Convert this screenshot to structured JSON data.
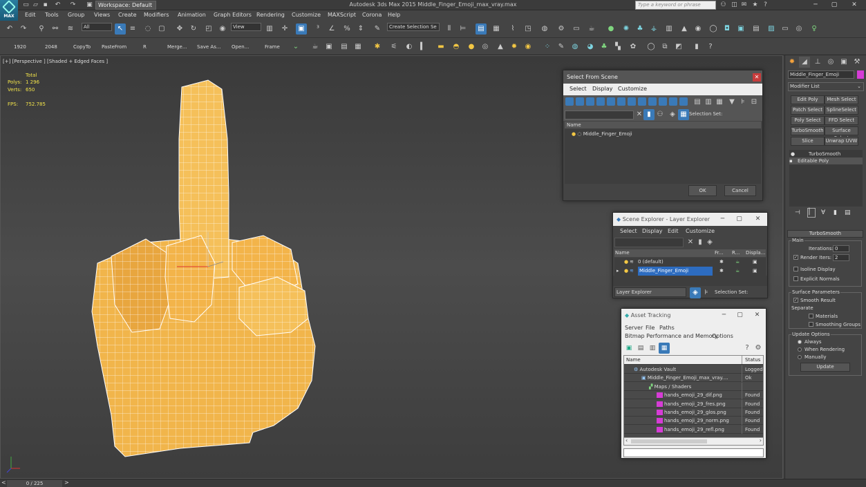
{
  "app": {
    "title": "Autodesk 3ds Max  2015     Middle_Finger_Emoji_max_vray.max",
    "logo_label": "MAX",
    "workspace": "Workspace: Default",
    "search_placeholder": "Type a keyword or phrase"
  },
  "menu": [
    "Edit",
    "Tools",
    "Group",
    "Views",
    "Create",
    "Modifiers",
    "Animation",
    "Graph Editors",
    "Rendering",
    "Customize",
    "MAXScript",
    "Corona",
    "Help"
  ],
  "toolbar": {
    "selection_filter": "All",
    "ref_coord": "View",
    "named_selection": "Create Selection Se"
  },
  "toolbar2": [
    "1920",
    "2048",
    "CopyTo",
    "PasteFrom",
    "R",
    "Merge...",
    "Save As...",
    "Open...",
    "Frame"
  ],
  "viewport": {
    "label": "[+] [Perspective ] [Shaded + Edged Faces ]",
    "stats": {
      "total_label": "Total",
      "polys_label": "Polys:",
      "polys_value": "1 296",
      "verts_label": "Verts:",
      "verts_value": "650",
      "fps_label": "FPS:",
      "fps_value": "752.785"
    },
    "model_color": "#f1b54b"
  },
  "select_from_scene": {
    "title": "Select From Scene",
    "menu": [
      "Select",
      "Display",
      "Customize"
    ],
    "selection_set_label": "Selection Set:",
    "column_name": "Name",
    "item": "Middle_Finger_Emoji",
    "ok": "OK",
    "cancel": "Cancel"
  },
  "scene_explorer": {
    "title": "Scene Explorer - Layer Explorer",
    "menu": [
      "Select",
      "Display",
      "Edit",
      "Customize"
    ],
    "columns": [
      "Name",
      "Fr...",
      "R...",
      "Displa..."
    ],
    "rows": [
      "0 (default)",
      "Middle_Finger_Emoji"
    ],
    "footer_dropdown": "Layer Explorer",
    "selection_set_label": "Selection Set:"
  },
  "asset_tracking": {
    "title": "Asset Tracking",
    "menu1": [
      "Server",
      "File",
      "Paths"
    ],
    "menu2": [
      "Bitmap Performance and Memory",
      "Options"
    ],
    "columns": [
      "Name",
      "Status"
    ],
    "rows": [
      {
        "name": "Autodesk Vault",
        "status": "Logged",
        "indent": 0
      },
      {
        "name": "Middle_Finger_Emoji_max_vray....",
        "status": "Ok",
        "indent": 1
      },
      {
        "name": "Maps / Shaders",
        "status": "",
        "indent": 2
      },
      {
        "name": "hands_emoji_29_dif.png",
        "status": "Found",
        "indent": 3
      },
      {
        "name": "hands_emoji_29_fres.png",
        "status": "Found",
        "indent": 3
      },
      {
        "name": "hands_emoji_29_glos.png",
        "status": "Found",
        "indent": 3
      },
      {
        "name": "hands_emoji_29_norm.png",
        "status": "Found",
        "indent": 3
      },
      {
        "name": "hands_emoji_29_refl.png",
        "status": "Found",
        "indent": 3
      }
    ]
  },
  "command_panel": {
    "object_name": "Middle_Finger_Emoji",
    "object_color": "#d63cd6",
    "modifier_list": "Modifier List",
    "mod_buttons": [
      "Edit Poly",
      "Mesh Select",
      "Patch Select",
      "SplineSelect",
      "Poly Select",
      "FFD Select",
      "TurboSmooth",
      "Surface Select",
      "Slice",
      "Unwrap UVW"
    ],
    "stack": [
      "TurboSmooth",
      "Editable Poly"
    ],
    "rollout_title": "TurboSmooth",
    "main_group": "Main",
    "iterations_label": "Iterations:",
    "iterations_value": "0",
    "render_iters_label": "Render Iters:",
    "render_iters_value": "2",
    "isoline_label": "Isoline Display",
    "explicit_normals_label": "Explicit Normals",
    "surface_group": "Surface Parameters",
    "smooth_result_label": "Smooth Result",
    "separate_label": "Separate",
    "materials_label": "Materials",
    "smoothing_groups_label": "Smoothing Groups",
    "update_group": "Update Options",
    "always_label": "Always",
    "when_rendering_label": "When Rendering",
    "manually_label": "Manually",
    "update_button": "Update"
  },
  "status": {
    "time_slider": "0 / 225"
  }
}
